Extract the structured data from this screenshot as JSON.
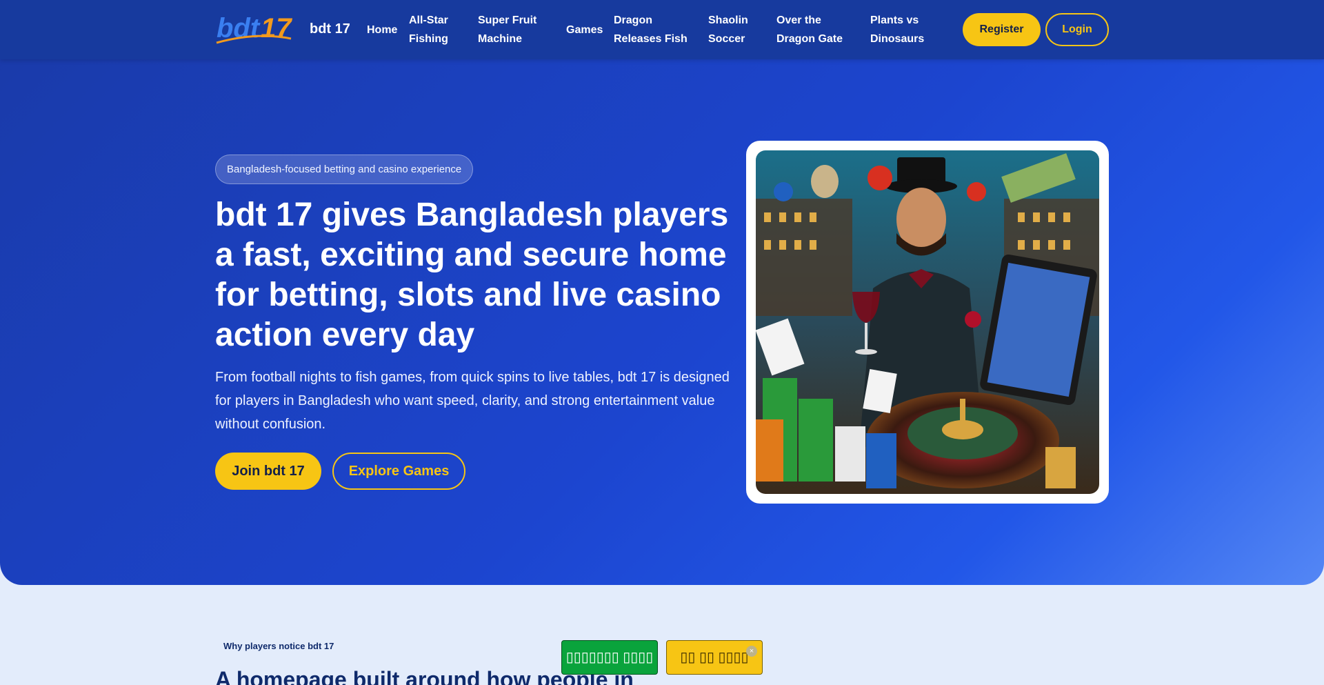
{
  "header": {
    "brand": "bdt 17",
    "nav": [
      {
        "label": "Home"
      },
      {
        "label": "All-Star Fishing"
      },
      {
        "label": "Super Fruit Machine"
      },
      {
        "label": "Games"
      },
      {
        "label": "Dragon Releases Fish"
      },
      {
        "label": "Shaolin Soccer"
      },
      {
        "label": "Over the Dragon Gate"
      },
      {
        "label": "Plants vs Dinosaurs"
      }
    ],
    "register_label": "Register",
    "login_label": "Login"
  },
  "hero": {
    "tagline": "Bangladesh-focused betting and casino experience",
    "headline": "bdt 17 gives Bangladesh players a fast, exciting and secure home for betting, slots and live casino action every day",
    "subtext": "From football nights to fish games, from quick spins to live tables, bdt 17 is designed for players in Bangladesh who want speed, clarity, and strong entertainment value without confusion.",
    "join_label": "Join bdt 17",
    "explore_label": "Explore Games"
  },
  "section": {
    "kicker": "Why players notice bdt 17",
    "title": "A homepage built around how people in"
  },
  "floating": {
    "green_label": "▯▯▯▯▯▯▯ ▯▯▯▯",
    "yellow_label": "▯▯ ▯▯ ▯▯▯▯",
    "close_icon": "×"
  },
  "colors": {
    "brand_blue": "#1c45cf",
    "accent_yellow": "#f7c514",
    "logo_orange": "#f29a1d"
  }
}
